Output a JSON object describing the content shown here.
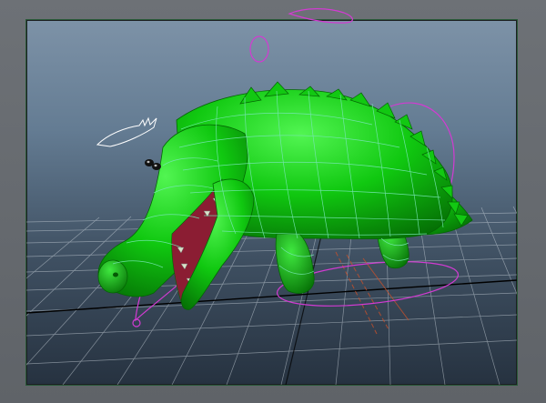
{
  "app": {
    "view": "perspective-viewport"
  },
  "colors": {
    "viewport_border": "#2a5a3a",
    "grid": "#c9d2da",
    "model_fill": "#0fd10f",
    "wireframe": "#76e6b4",
    "rig_curves": "#d23bd2",
    "mouth_interior": "#8b1d33",
    "eye": "#111111",
    "origin_axis": "#000000",
    "control_lines": "#c8502a"
  },
  "icons": {
    "camera": "camera-icon",
    "eye_locator": "eye-locator-icon",
    "control_circle": "nurbs-circle-icon"
  },
  "scene": {
    "object": "crocodile-model",
    "selection_highlight": true,
    "grid_visible": true
  }
}
